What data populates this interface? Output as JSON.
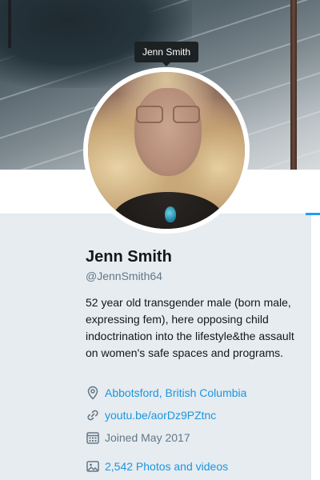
{
  "tooltip": {
    "text": "Jenn Smith"
  },
  "profile": {
    "name": "Jenn Smith",
    "handle": "@JennSmith64",
    "bio": "52 year old transgender male (born male, expressing fem), here opposing child indoctrination into the lifestyle&the assault on women's safe spaces and programs."
  },
  "meta": {
    "location": "Abbotsford, British Columbia",
    "website": "youtu.be/aorDz9PZtnc",
    "joined": "Joined May 2017",
    "photos": "2,542 Photos and videos"
  },
  "icons": {
    "location": "location-pin-icon",
    "website": "link-icon",
    "joined": "calendar-icon",
    "photos": "photo-icon"
  },
  "colors": {
    "link": "#1b95e0",
    "muted": "#657786",
    "text": "#14171a",
    "background": "#e6ecf0",
    "accent": "#1da1f2"
  }
}
